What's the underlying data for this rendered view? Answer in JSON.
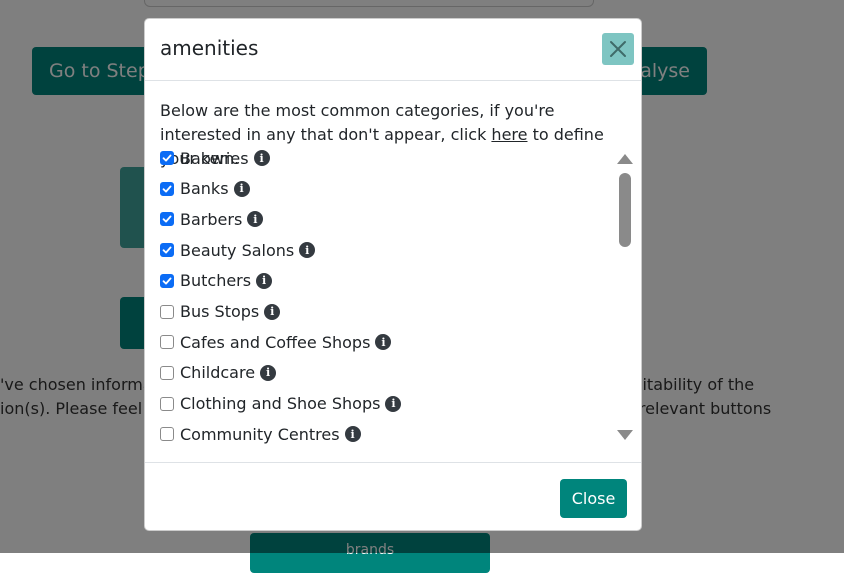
{
  "background": {
    "step_button": "Go to Step",
    "analyse_button": "alyse",
    "text_left_1": "'ve chosen informa",
    "text_left_2": "ion(s). Please feel fr",
    "text_right_1": "suitability of the",
    "text_right_2": "e relevant buttons",
    "brands_button": "brands"
  },
  "modal": {
    "title": "amenities",
    "intro_before_link": "Below are the most common categories, if you're interested in any that don't appear, click ",
    "intro_link": "here",
    "intro_after_link": " to define your own.",
    "info_glyph": "i",
    "items": [
      {
        "label": "Bakeries",
        "checked": true
      },
      {
        "label": "Banks",
        "checked": true
      },
      {
        "label": "Barbers",
        "checked": true
      },
      {
        "label": "Beauty Salons",
        "checked": true
      },
      {
        "label": "Butchers",
        "checked": true
      },
      {
        "label": "Bus Stops",
        "checked": false
      },
      {
        "label": "Cafes and Coffee Shops",
        "checked": false
      },
      {
        "label": "Childcare",
        "checked": false
      },
      {
        "label": "Clothing and Shoe Shops",
        "checked": false
      },
      {
        "label": "Community Centres",
        "checked": false
      }
    ],
    "close_button": "Close"
  },
  "colors": {
    "accent": "#00857c",
    "checkbox_checked": "#0b6cf5",
    "close_x_bg": "#7ec5c2"
  }
}
